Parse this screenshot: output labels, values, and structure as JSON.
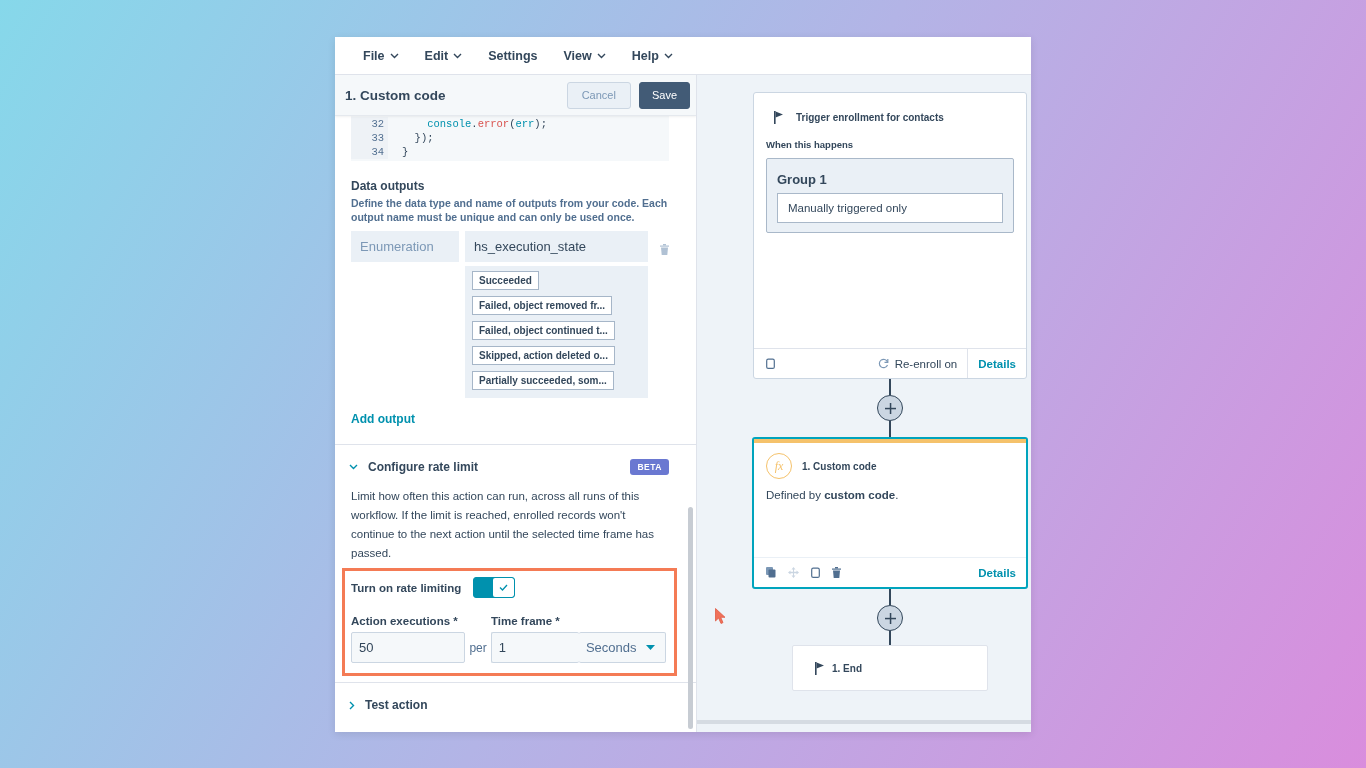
{
  "menu": [
    {
      "label": "File",
      "dropdown": true
    },
    {
      "label": "Edit",
      "dropdown": true
    },
    {
      "label": "Settings",
      "dropdown": false
    },
    {
      "label": "View",
      "dropdown": true
    },
    {
      "label": "Help",
      "dropdown": true
    }
  ],
  "panel": {
    "title": "1. Custom code",
    "buttons": [
      {
        "label": "Cancel",
        "kind": "secondary"
      },
      {
        "label": "Save",
        "kind": "primary"
      }
    ],
    "code": [
      {
        "number": "32",
        "segments": [
          {
            "text": "    console",
            "kind": "object"
          },
          {
            "text": ".",
            "kind": "plain"
          },
          {
            "text": "error",
            "kind": "method"
          },
          {
            "text": "(",
            "kind": "plain"
          },
          {
            "text": "err",
            "kind": "object"
          },
          {
            "text": ");",
            "kind": "plain"
          }
        ]
      },
      {
        "number": "33",
        "segments": [
          {
            "text": "  });",
            "kind": "plain"
          }
        ]
      },
      {
        "number": "34",
        "segments": [
          {
            "text": "}",
            "kind": "plain"
          }
        ]
      }
    ],
    "data_outputs": {
      "title": "Data outputs",
      "description": "Define the data type and name of outputs from your code. Each output name must be unique and can only be used once.",
      "rows": [
        {
          "type": "Enumeration",
          "name": "hs_execution_state",
          "options": [
            "Succeeded",
            "Failed, object removed fr...",
            "Failed, object continued t...",
            "Skipped, action deleted o...",
            "Partially succeeded, som..."
          ]
        }
      ],
      "add_link": "Add output"
    },
    "rate_limit": {
      "title": "Configure rate limit",
      "expanded": true,
      "badge": "BETA",
      "description": "Limit how often this action can run, across all runs of this workflow. If the limit is reached, enrolled records won't continue to the next action until the selected time frame has passed.",
      "toggle": {
        "label": "Turn on rate limiting",
        "on": true
      },
      "executions": {
        "label": "Action executions *",
        "value": "50"
      },
      "per": "per",
      "time_frame": {
        "label": "Time frame *",
        "value": "1",
        "unit": "Seconds"
      }
    },
    "test_action": {
      "title": "Test action",
      "expanded": false
    }
  },
  "canvas": {
    "trigger": {
      "title": "Trigger enrollment for contacts",
      "subtitle": "When this happens",
      "group": "Group 1",
      "condition": "Manually triggered only",
      "reenroll": "Re-enroll on",
      "details": "Details",
      "selected": false
    },
    "action": {
      "icon": "fx",
      "title": "1. Custom code",
      "description": "Defined by **custom code**.",
      "details": "Details",
      "selected": true
    },
    "end": {
      "title": "1. End"
    }
  }
}
